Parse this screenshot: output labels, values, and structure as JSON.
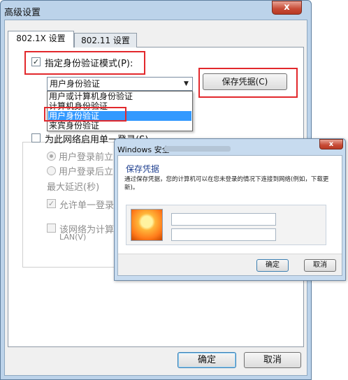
{
  "main_dialog": {
    "title": "高级设置",
    "close_glyph": "x",
    "tabs": [
      {
        "label": "802.1X 设置",
        "active": true
      },
      {
        "label": "802.11 设置",
        "active": false
      }
    ],
    "specify_auth": {
      "label": "指定身份验证模式(P):",
      "checked": true,
      "check_glyph": "✓"
    },
    "auth_combo": {
      "selected": "用户身份验证",
      "arrow_glyph": "▼",
      "options": [
        "用户或计算机身份验证",
        "计算机身份验证",
        "用户身份验证",
        "来宾身份验证"
      ],
      "highlighted_index": 2
    },
    "save_credentials_button": "保存凭据(C)",
    "single_sign_on": {
      "label": "为此网络启用单一登录(S)",
      "checked": false,
      "radio_before": "用户登录前立",
      "radio_after": "用户登录后立",
      "max_delay": "最大延迟(秒)",
      "allow_dialogs": "允许单一登录",
      "allow_dialogs_glyph": "✓",
      "separate_vlan": "该网络为计算",
      "separate_vlan_suffix": "LAN(V)"
    },
    "ok_button": "确定",
    "cancel_button": "取消"
  },
  "save_credentials_dialog": {
    "title": "Windows 安全",
    "close_glyph": "x",
    "heading": "保存凭据",
    "description": "通过保存凭据，您的计算机可以在您未登录的情况下连接到网络(例如，下载更新)。",
    "username_value": "",
    "password_value": "",
    "ok_button": "确定",
    "cancel_button": "取消"
  },
  "colors": {
    "highlight_red": "#e2282c",
    "selection_blue": "#3399ff",
    "window_frame": "#bcd3ea",
    "heading_blue": "#1e3f8f"
  }
}
